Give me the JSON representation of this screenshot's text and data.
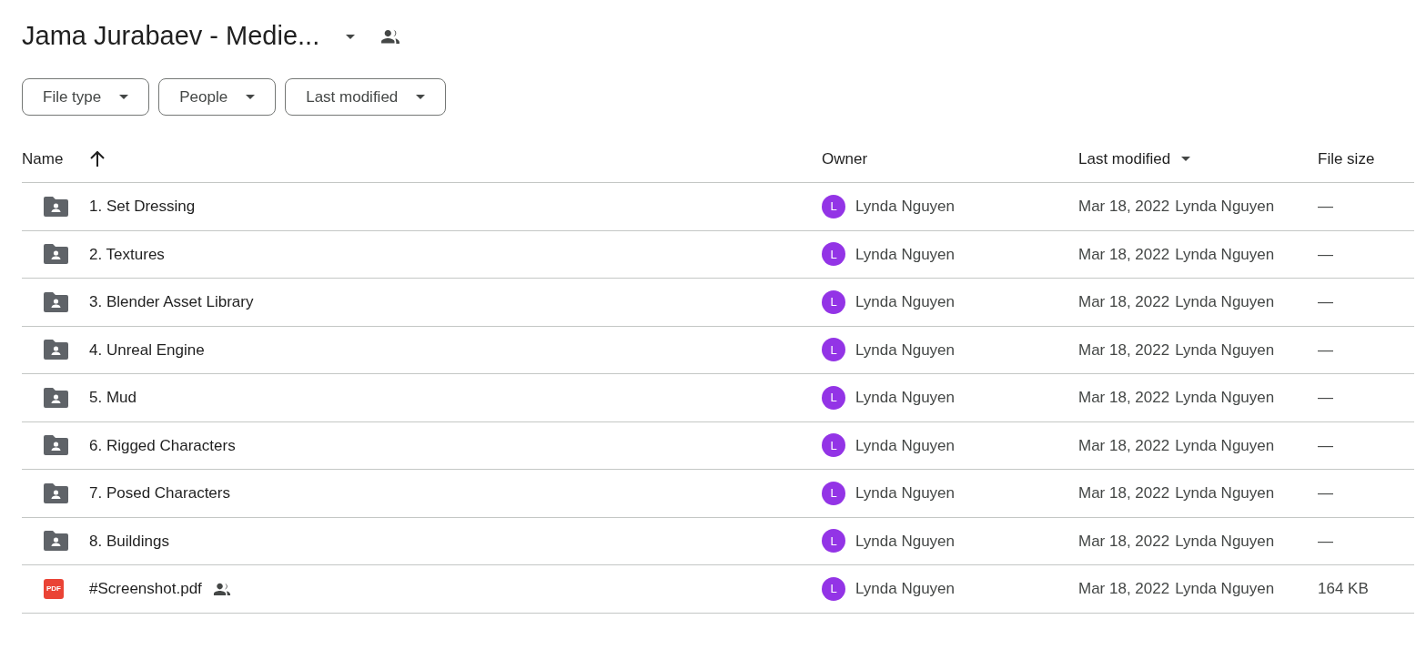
{
  "title": "Jama Jurabaev - Medie...",
  "filters": [
    "File type",
    "People",
    "Last modified"
  ],
  "columns": [
    {
      "label": "Name",
      "kind": "sort-arrow"
    },
    {
      "label": "Owner",
      "kind": "plain"
    },
    {
      "label": "Last modified",
      "kind": "caret"
    },
    {
      "label": "File size",
      "kind": "plain"
    }
  ],
  "rows": [
    {
      "name": "1. Set Dressing",
      "kind": "shared-folder",
      "shared": false,
      "owner_initial": "L",
      "owner": "Lynda Nguyen",
      "modified_date": "Mar 18, 2022",
      "modified_by": "Lynda Nguyen",
      "size": "—"
    },
    {
      "name": "2. Textures",
      "kind": "shared-folder",
      "shared": false,
      "owner_initial": "L",
      "owner": "Lynda Nguyen",
      "modified_date": "Mar 18, 2022",
      "modified_by": "Lynda Nguyen",
      "size": "—"
    },
    {
      "name": "3. Blender Asset Library",
      "kind": "shared-folder",
      "shared": false,
      "owner_initial": "L",
      "owner": "Lynda Nguyen",
      "modified_date": "Mar 18, 2022",
      "modified_by": "Lynda Nguyen",
      "size": "—"
    },
    {
      "name": "4. Unreal Engine",
      "kind": "shared-folder",
      "shared": false,
      "owner_initial": "L",
      "owner": "Lynda Nguyen",
      "modified_date": "Mar 18, 2022",
      "modified_by": "Lynda Nguyen",
      "size": "—"
    },
    {
      "name": "5. Mud",
      "kind": "shared-folder",
      "shared": false,
      "owner_initial": "L",
      "owner": "Lynda Nguyen",
      "modified_date": "Mar 18, 2022",
      "modified_by": "Lynda Nguyen",
      "size": "—"
    },
    {
      "name": "6. Rigged Characters",
      "kind": "shared-folder",
      "shared": false,
      "owner_initial": "L",
      "owner": "Lynda Nguyen",
      "modified_date": "Mar 18, 2022",
      "modified_by": "Lynda Nguyen",
      "size": "—"
    },
    {
      "name": "7. Posed Characters",
      "kind": "shared-folder",
      "shared": false,
      "owner_initial": "L",
      "owner": "Lynda Nguyen",
      "modified_date": "Mar 18, 2022",
      "modified_by": "Lynda Nguyen",
      "size": "—"
    },
    {
      "name": "8. Buildings",
      "kind": "shared-folder",
      "shared": false,
      "owner_initial": "L",
      "owner": "Lynda Nguyen",
      "modified_date": "Mar 18, 2022",
      "modified_by": "Lynda Nguyen",
      "size": "—"
    },
    {
      "name": "#Screenshot.pdf",
      "kind": "pdf",
      "icon_label": "PDF",
      "shared": true,
      "owner_initial": "L",
      "owner": "Lynda Nguyen",
      "modified_date": "Mar 18, 2022",
      "modified_by": "Lynda Nguyen",
      "size": "164 KB"
    }
  ]
}
